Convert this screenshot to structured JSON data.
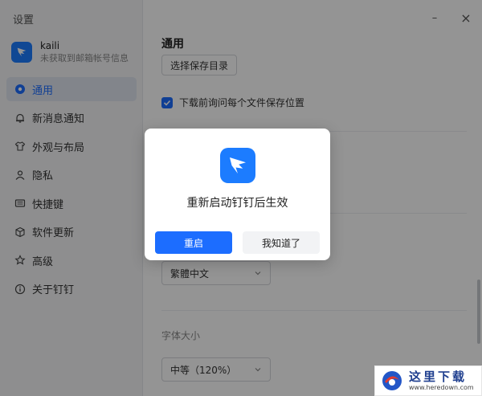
{
  "window": {
    "title": "设置",
    "minimize_symbol": "–",
    "close_symbol": "×"
  },
  "account": {
    "name": "kaili",
    "subtitle": "未获取到邮箱帐号信息"
  },
  "sidebar": {
    "items": [
      {
        "label": "通用",
        "icon": "gear-icon",
        "active": true
      },
      {
        "label": "新消息通知",
        "icon": "bell-icon"
      },
      {
        "label": "外观与布局",
        "icon": "shirt-icon"
      },
      {
        "label": "隐私",
        "icon": "person-icon"
      },
      {
        "label": "快捷键",
        "icon": "keyboard-icon"
      },
      {
        "label": "软件更新",
        "icon": "cube-icon"
      },
      {
        "label": "高级",
        "icon": "star-icon"
      },
      {
        "label": "关于钉钉",
        "icon": "info-icon"
      }
    ]
  },
  "main": {
    "section_title": "通用",
    "choose_dir_button": "选择保存目录",
    "ask_save_location": {
      "label": "下载前询问每个文件保存位置",
      "checked": true
    },
    "language_select": {
      "value": "繁體中文"
    },
    "font_size": {
      "label": "字体大小",
      "value": "中等（120%）"
    }
  },
  "dialog": {
    "message": "重新启动钉钉后生效",
    "restart_button": "重启",
    "ok_button": "我知道了"
  },
  "watermark": {
    "text": "这里下载",
    "url": "www.heredown.com"
  },
  "colors": {
    "accent": "#1c6dff",
    "logo": "#1c7cff",
    "overlay": "rgba(0,0,0,0.42)"
  }
}
